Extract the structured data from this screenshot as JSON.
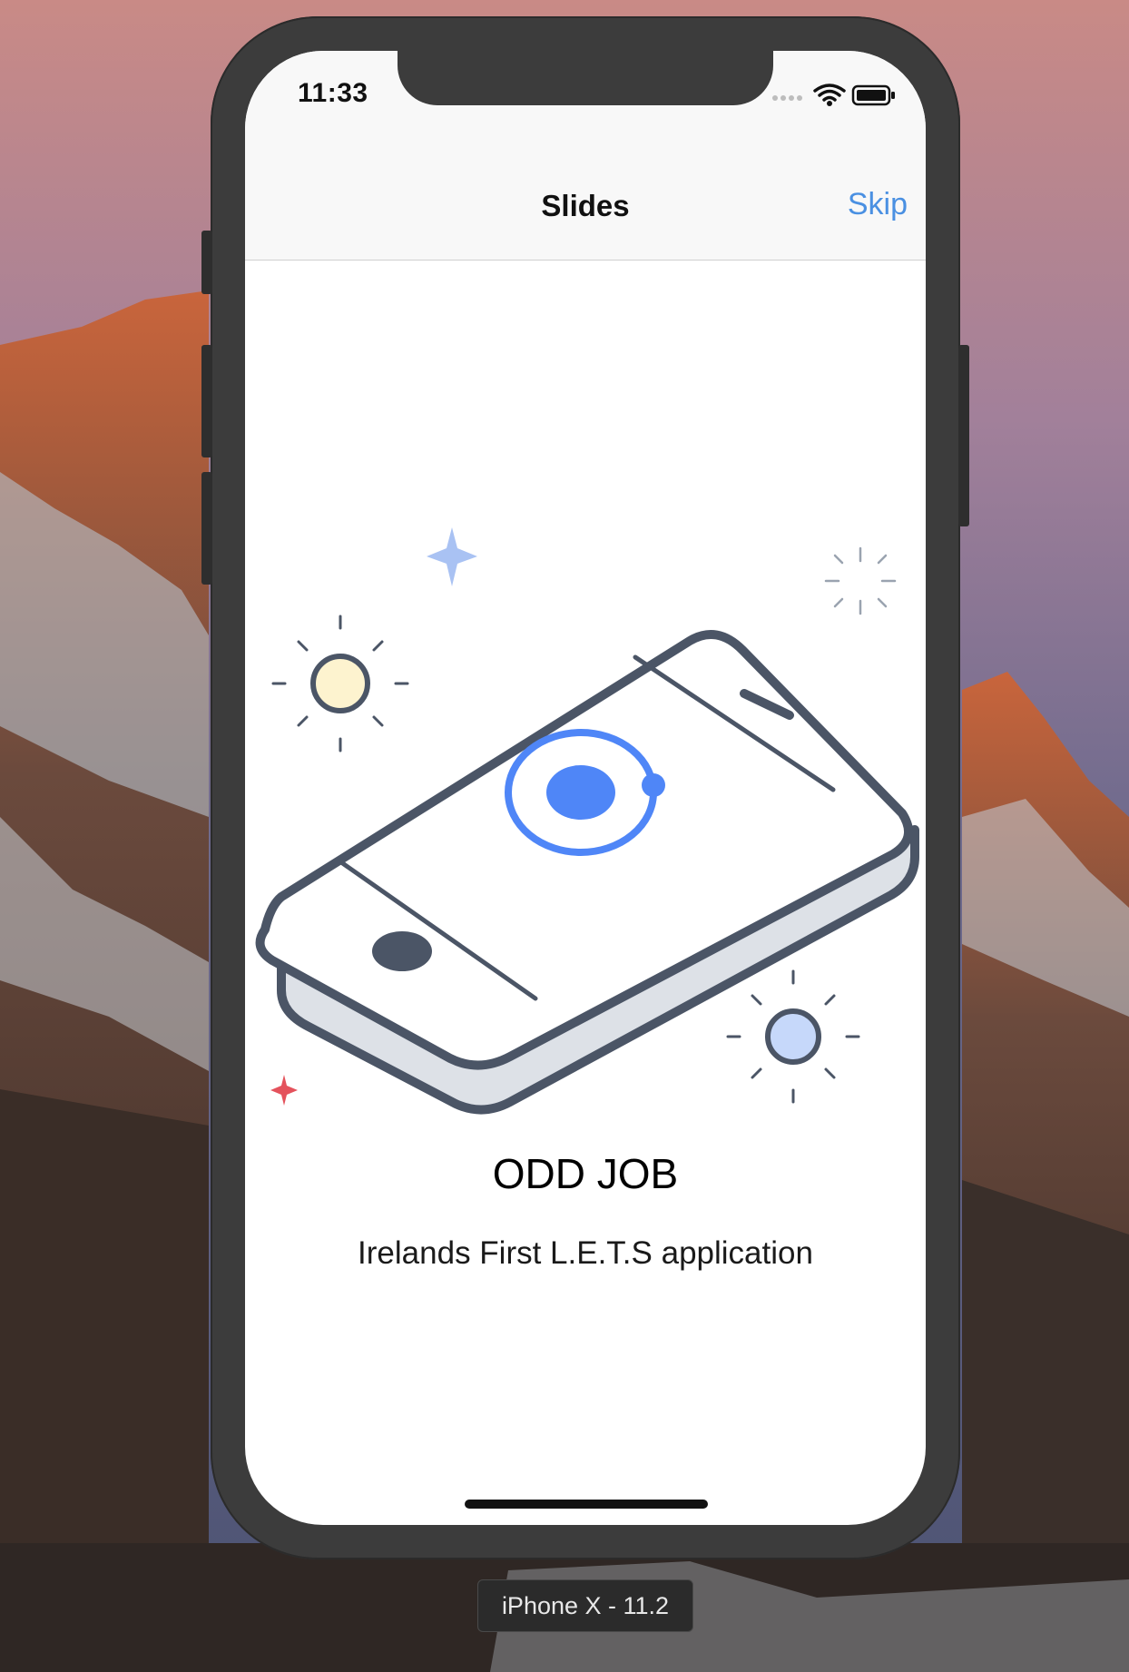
{
  "status_bar": {
    "time": "11:33",
    "icons": [
      "signal-dots-icon",
      "wifi-icon",
      "battery-icon"
    ]
  },
  "nav_bar": {
    "title": "Slides",
    "skip_label": "Skip"
  },
  "slide": {
    "illustration": "phone-illustration-icon",
    "title": "ODD JOB",
    "description": "Irelands First L.E.T.S application"
  },
  "simulator": {
    "device_label": "iPhone X - 11.2"
  },
  "colors": {
    "accent": "#4a90e2",
    "ionic_blue": "#4f86f7",
    "outline": "#4b5566",
    "frame": "#3c3c3c"
  }
}
